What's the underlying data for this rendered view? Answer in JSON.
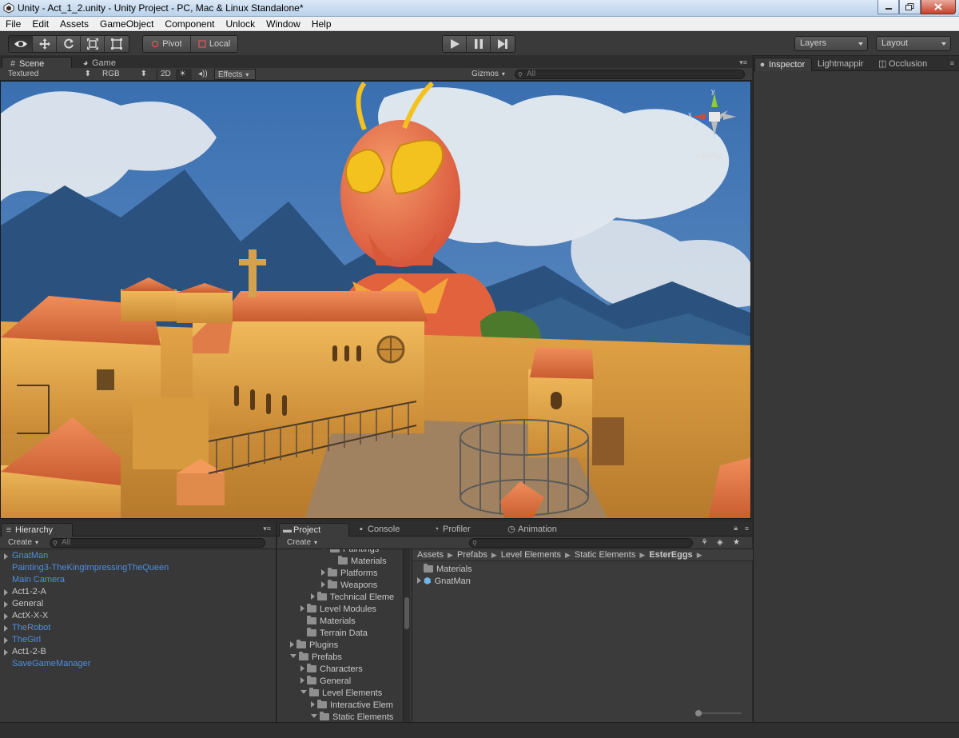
{
  "window": {
    "title": "Unity - Act_1_2.unity - Unity Project - PC, Mac & Linux Standalone*"
  },
  "menu": [
    "File",
    "Edit",
    "Assets",
    "GameObject",
    "Component",
    "Unlock",
    "Window",
    "Help"
  ],
  "toolbar": {
    "pivot_label": "Pivot",
    "local_label": "Local",
    "layers_label": "Layers",
    "layout_label": "Layout"
  },
  "scene_tabs": {
    "scene": "Scene",
    "game": "Game"
  },
  "scene_bar": {
    "render_mode": "Textured",
    "channel": "RGB",
    "mode_2d": "2D",
    "effects": "Effects",
    "gizmos": "Gizmos",
    "search_placeholder": "All"
  },
  "gizmo": {
    "axis_y": "y",
    "axis_x": "x",
    "axis_z": "z",
    "projection": "< Persp"
  },
  "inspector_tabs": {
    "inspector": "Inspector",
    "lightmapping": "Lightmappir",
    "occlusion": "Occlusion"
  },
  "hierarchy": {
    "tab": "Hierarchy",
    "create": "Create",
    "search_placeholder": "All",
    "items": [
      {
        "label": "GnatMan",
        "expandable": true,
        "blue": true
      },
      {
        "label": "Painting3-TheKingImpressingTheQueen",
        "expandable": false,
        "blue": true
      },
      {
        "label": "Main Camera",
        "expandable": false,
        "blue": true
      },
      {
        "label": "Act1-2-A",
        "expandable": true,
        "blue": false
      },
      {
        "label": "General",
        "expandable": true,
        "blue": false
      },
      {
        "label": "ActX-X-X",
        "expandable": true,
        "blue": false
      },
      {
        "label": "TheRobot",
        "expandable": true,
        "blue": true
      },
      {
        "label": "TheGirl",
        "expandable": true,
        "blue": true
      },
      {
        "label": "Act1-2-B",
        "expandable": true,
        "blue": false
      },
      {
        "label": "SaveGameManager",
        "expandable": false,
        "blue": true
      }
    ]
  },
  "project": {
    "tabs": {
      "project": "Project",
      "console": "Console",
      "profiler": "Profiler",
      "animation": "Animation"
    },
    "create": "Create",
    "tree": [
      {
        "label": "Paintings",
        "indent": 3,
        "arrow": "open"
      },
      {
        "label": "Materials",
        "indent": 4,
        "arrow": "none"
      },
      {
        "label": "Platforms",
        "indent": 3,
        "arrow": "closed"
      },
      {
        "label": "Weapons",
        "indent": 3,
        "arrow": "closed"
      },
      {
        "label": "Technical Eleme",
        "indent": 2,
        "arrow": "closed"
      },
      {
        "label": "Level Modules",
        "indent": 1,
        "arrow": "closed"
      },
      {
        "label": "Materials",
        "indent": 1,
        "arrow": "none"
      },
      {
        "label": "Terrain Data",
        "indent": 1,
        "arrow": "none"
      },
      {
        "label": "Plugins",
        "indent": 0,
        "arrow": "closed"
      },
      {
        "label": "Prefabs",
        "indent": 0,
        "arrow": "open"
      },
      {
        "label": "Characters",
        "indent": 1,
        "arrow": "closed"
      },
      {
        "label": "General",
        "indent": 1,
        "arrow": "closed"
      },
      {
        "label": "Level Elements",
        "indent": 1,
        "arrow": "open"
      },
      {
        "label": "Interactive Elem",
        "indent": 2,
        "arrow": "closed"
      },
      {
        "label": "Static Elements",
        "indent": 2,
        "arrow": "open"
      }
    ],
    "breadcrumb": [
      "Assets",
      "Prefabs",
      "Level Elements",
      "Static Elements",
      "EsterEggs"
    ],
    "assets": [
      {
        "label": "Materials",
        "kind": "folder"
      },
      {
        "label": "GnatMan",
        "kind": "prefab"
      }
    ]
  }
}
